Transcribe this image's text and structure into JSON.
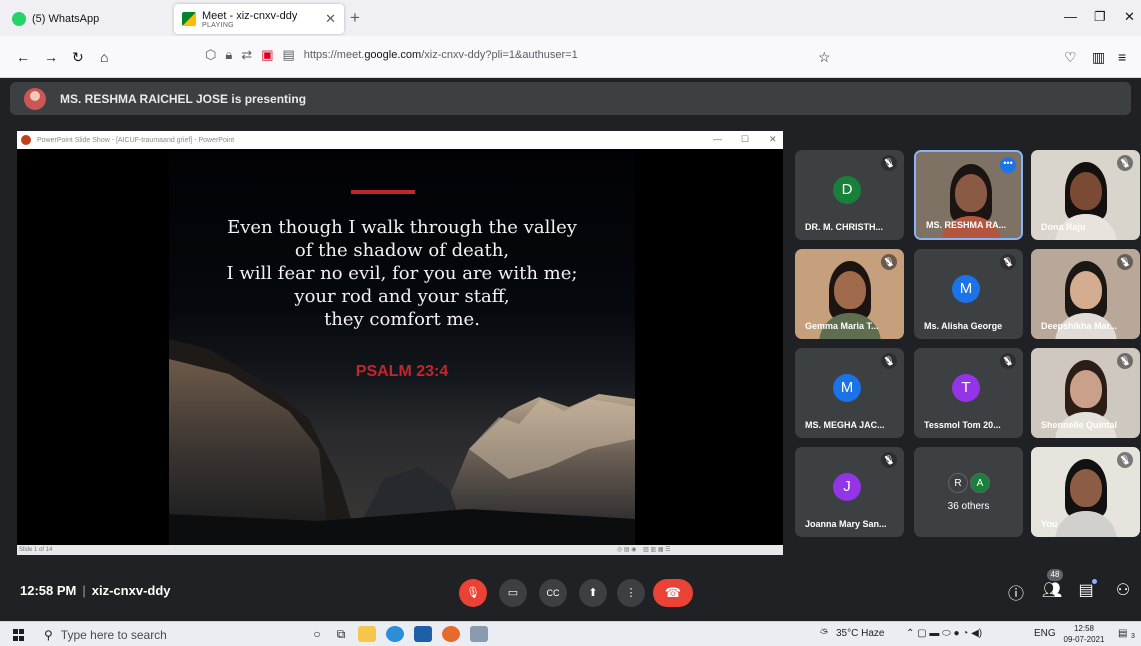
{
  "browser": {
    "tabs": [
      {
        "title": "(5) WhatsApp",
        "subtitle": ""
      },
      {
        "title": "Meet - xiz-cnxv-ddy",
        "subtitle": "PLAYING"
      }
    ],
    "url_prefix": "https://meet.",
    "url_domain": "google.com",
    "url_path": "/xiz-cnxv-ddy?pli=1&authuser=1"
  },
  "meet": {
    "presenting_text": "MS. RESHMA RAICHEL JOSE is presenting",
    "time": "12:58 PM",
    "meeting_code": "xiz-cnxv-ddy",
    "participant_count": "48",
    "participants": [
      {
        "name": "DR. M. CHRISTH...",
        "initial": "D",
        "color": "#188038",
        "type": "avatar",
        "muted": true
      },
      {
        "name": "MS. RESHMA RA...",
        "initial": "",
        "color": "",
        "type": "video",
        "muted": false,
        "speaking": true
      },
      {
        "name": "Dona Raju",
        "initial": "",
        "color": "",
        "type": "video",
        "muted": true
      },
      {
        "name": "Gemma Maria T...",
        "initial": "",
        "color": "",
        "type": "video",
        "muted": true
      },
      {
        "name": "Ms. Alisha George",
        "initial": "M",
        "color": "#1a73e8",
        "type": "avatar",
        "muted": true
      },
      {
        "name": "Deepshikha Mar...",
        "initial": "",
        "color": "",
        "type": "video",
        "muted": true
      },
      {
        "name": "MS. MEGHA JAC...",
        "initial": "M",
        "color": "#1a73e8",
        "type": "avatar",
        "muted": true
      },
      {
        "name": "Tessmol Tom 20...",
        "initial": "T",
        "color": "#9334e6",
        "type": "avatar",
        "muted": true
      },
      {
        "name": "Shennelle Quintal",
        "initial": "",
        "color": "",
        "type": "video",
        "muted": true
      },
      {
        "name": "Joanna Mary San...",
        "initial": "J",
        "color": "#9334e6",
        "type": "avatar",
        "muted": true
      },
      {
        "name": "36 others",
        "initial": "",
        "color": "",
        "type": "others",
        "muted": false,
        "minis": [
          "R",
          "A"
        ]
      },
      {
        "name": "You",
        "initial": "",
        "color": "",
        "type": "video",
        "muted": true
      }
    ]
  },
  "powerpoint": {
    "window_title": "PowerPoint Slide Show - [AICUF-traumaand grief] - PowerPoint",
    "verse_lines": [
      "Even though I walk through the valley",
      "of the shadow of death,",
      "I will fear no evil, for you are with me;",
      "your rod and your staff,",
      "they comfort me."
    ],
    "reference": "PSALM 23:4",
    "status": "Slide 1 of 14"
  },
  "taskbar": {
    "search_placeholder": "Type here to search",
    "weather": "35°C Haze",
    "language": "ENG",
    "clock_time": "12:58",
    "clock_date": "09-07-2021",
    "notification_count": "3"
  }
}
